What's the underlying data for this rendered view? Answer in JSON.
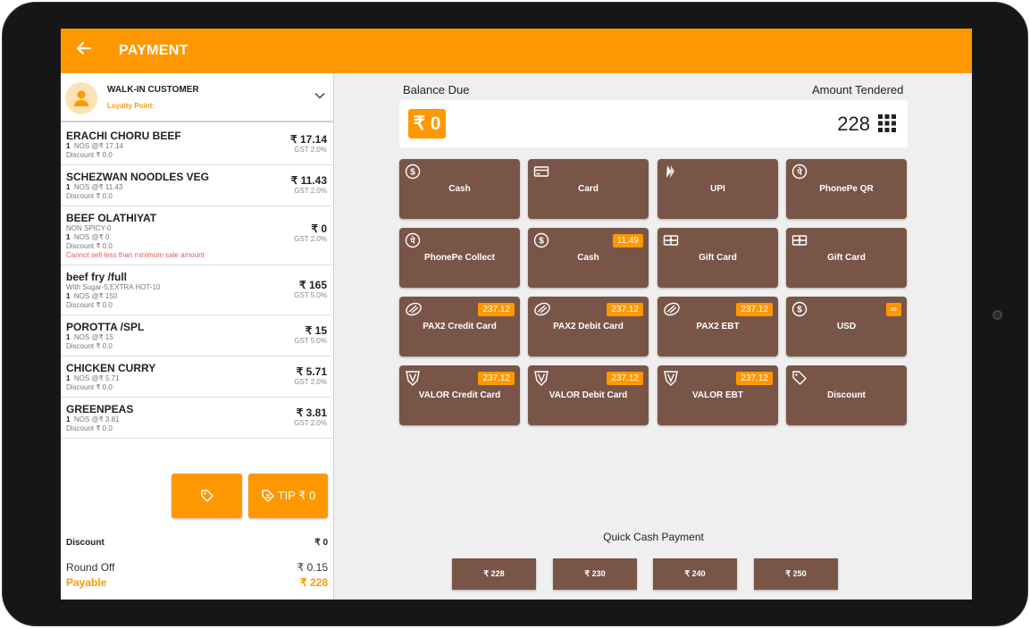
{
  "header": {
    "title": "PAYMENT"
  },
  "customer": {
    "name": "WALK-IN CUSTOMER",
    "loyalty_label": "Loyalty Point:"
  },
  "cart": [
    {
      "name": "ERACHI CHORU BEEF",
      "qty": "1",
      "rate": "NOS @₹ 17.14",
      "discount": "Discount ₹ 0.0",
      "price": "₹ 17.14",
      "gst": "GST 2.0%"
    },
    {
      "name": "SCHEZWAN NOODLES VEG",
      "qty": "1",
      "rate": "NOS @₹ 11.43",
      "discount": "Discount ₹ 0.0",
      "price": "₹ 11.43",
      "gst": "GST 2.0%"
    },
    {
      "name": "BEEF OLATHIYAT",
      "modifier": "NON SPICY-0",
      "qty": "1",
      "rate": "NOS @₹ 0",
      "discount": "Discount ₹ 0.0",
      "error": "Cannot sell less than minimum sale amount",
      "price": "₹ 0",
      "gst": "GST 2.0%"
    },
    {
      "name": "beef fry /full",
      "modifier": "With Sugar-5,EXTRA HOT-10",
      "qty": "1",
      "rate": "NOS @₹ 150",
      "discount": "Discount ₹ 0.0",
      "price": "₹ 165",
      "gst": "GST 5.0%"
    },
    {
      "name": "POROTTA /SPL",
      "qty": "1",
      "rate": "NOS @₹ 15",
      "discount": "Discount ₹ 0.0",
      "price": "₹ 15",
      "gst": "GST 5.0%"
    },
    {
      "name": "CHICKEN CURRY",
      "qty": "1",
      "rate": "NOS @₹ 5.71",
      "discount": "Discount ₹ 0.0",
      "price": "₹ 5.71",
      "gst": "GST 2.0%"
    },
    {
      "name": "GREENPEAS",
      "qty": "1",
      "rate": "NOS @₹ 3.81",
      "discount": "Discount ₹ 0.0",
      "price": "₹ 3.81",
      "gst": "GST 2.0%"
    }
  ],
  "tip": {
    "label": "TIP ₹ 0"
  },
  "summary": {
    "discount_label": "Discount",
    "discount_value": "₹ 0",
    "roundoff_label": "Round Off",
    "roundoff_value": "₹ 0.15",
    "payable_label": "Payable",
    "payable_value": "₹ 228"
  },
  "balance": {
    "label": "Balance Due",
    "value": "₹ 0"
  },
  "tendered": {
    "label": "Amount Tendered",
    "value": "228"
  },
  "tiles": [
    {
      "label": "Cash",
      "icon": "dollar-icon"
    },
    {
      "label": "Card",
      "icon": "card-icon"
    },
    {
      "label": "UPI",
      "icon": "upi-icon"
    },
    {
      "label": "PhonePe QR",
      "icon": "phonepe-icon"
    },
    {
      "label": "PhonePe Collect",
      "icon": "phonepe-icon"
    },
    {
      "label": "Cash",
      "icon": "dollar-icon",
      "badge": "11.49"
    },
    {
      "label": "Gift Card",
      "icon": "gift-card-icon"
    },
    {
      "label": "Gift Card",
      "icon": "gift-card-icon"
    },
    {
      "label": "PAX2 Credit Card",
      "icon": "pax-icon",
      "badge": "237.12"
    },
    {
      "label": "PAX2 Debit Card",
      "icon": "pax-icon",
      "badge": "237.12"
    },
    {
      "label": "PAX2 EBT",
      "icon": "pax-icon",
      "badge": "237.12"
    },
    {
      "label": "USD",
      "icon": "dollar-icon",
      "badge": "∞"
    },
    {
      "label": "VALOR Credit Card",
      "icon": "valor-icon",
      "badge": "237.12"
    },
    {
      "label": "VALOR Debit Card",
      "icon": "valor-icon",
      "badge": "237.12"
    },
    {
      "label": "VALOR EBT",
      "icon": "valor-icon",
      "badge": "237.12"
    },
    {
      "label": "Discount",
      "icon": "tag-icon"
    }
  ],
  "quick_cash": {
    "label": "Quick Cash Payment",
    "amounts": [
      "₹ 228",
      "₹ 230",
      "₹ 240",
      "₹ 250"
    ]
  },
  "colors": {
    "accent": "#ff9800",
    "tile": "#795548",
    "error": "#e35d5d"
  }
}
